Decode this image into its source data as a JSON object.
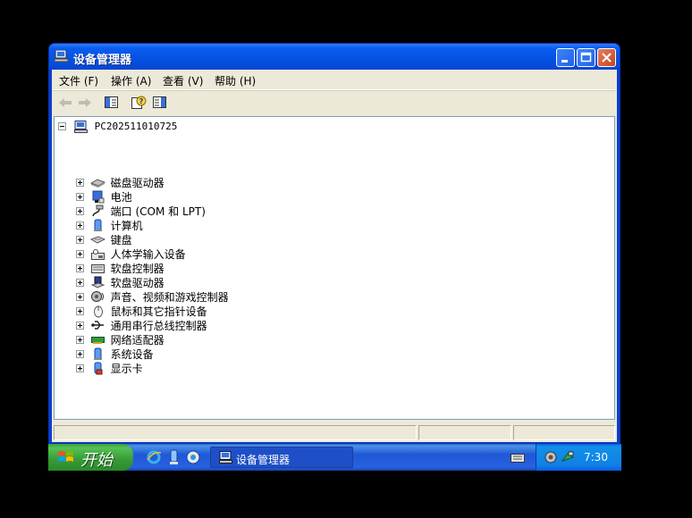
{
  "window": {
    "title": "设备管理器",
    "minimize_icon": "minimize-icon",
    "maximize_icon": "maximize-icon",
    "close_icon": "close-icon"
  },
  "menu": [
    {
      "label": "文件 (F)"
    },
    {
      "label": "操作 (A)"
    },
    {
      "label": "查看 (V)"
    },
    {
      "label": "帮助 (H)"
    }
  ],
  "toolbar": [
    {
      "icon": "back-arrow-icon",
      "enabled": false
    },
    {
      "icon": "forward-arrow-icon",
      "enabled": false
    },
    {
      "icon": "show-hide-console-tree-icon",
      "enabled": true
    },
    {
      "icon": "help-icon",
      "enabled": true
    },
    {
      "icon": "show-hide-action-pane-icon",
      "enabled": true
    }
  ],
  "tree": {
    "root": {
      "label": "PC202511010725",
      "icon": "computer-icon",
      "expanded": true
    },
    "children": [
      {
        "label": "磁盘驱动器",
        "icon": "disk-drive-icon"
      },
      {
        "label": "电池",
        "icon": "battery-icon"
      },
      {
        "label": "端口 (COM 和 LPT)",
        "icon": "port-icon"
      },
      {
        "label": "计算机",
        "icon": "computer-icon"
      },
      {
        "label": "键盘",
        "icon": "keyboard-icon"
      },
      {
        "label": "人体学输入设备",
        "icon": "hid-icon"
      },
      {
        "label": "软盘控制器",
        "icon": "floppy-controller-icon"
      },
      {
        "label": "软盘驱动器",
        "icon": "floppy-drive-icon"
      },
      {
        "label": "声音、视频和游戏控制器",
        "icon": "sound-icon"
      },
      {
        "label": "鼠标和其它指针设备",
        "icon": "mouse-icon"
      },
      {
        "label": "通用串行总线控制器",
        "icon": "usb-icon"
      },
      {
        "label": "网络适配器",
        "icon": "network-adapter-icon"
      },
      {
        "label": "系统设备",
        "icon": "system-device-icon"
      },
      {
        "label": "显示卡",
        "icon": "display-adapter-icon"
      }
    ]
  },
  "taskbar": {
    "start_label": "开始",
    "task_label": "设备管理器",
    "clock": "7:30",
    "quick_launch": [
      "internet-explorer-icon",
      "show-desktop-icon",
      "media-player-icon"
    ]
  },
  "colors": {
    "title_bar": "#0553e3",
    "client_bg": "#ece9d8",
    "start_green": "#379a37"
  }
}
